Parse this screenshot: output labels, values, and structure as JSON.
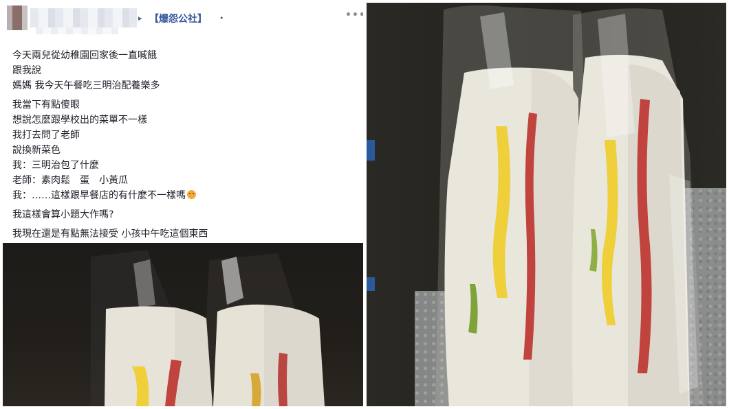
{
  "post": {
    "group_name": "【爆怨公社】",
    "arrow": "▸",
    "dot": "•",
    "more": "•••",
    "lines": [
      "今天兩兒從幼稚園回家後一直喊餓",
      "跟我說",
      "媽媽 我今天午餐吃三明治配養樂多",
      "",
      "我當下有點傻眼",
      "想說怎麼跟學校出的菜單不一樣",
      "我打去問了老師",
      "說換新菜色",
      "我：三明治包了什麼",
      "老師：素肉鬆　蛋　小黃瓜",
      "我：……這樣跟早餐店的有什麼不一樣嗎",
      "",
      "我這樣會算小題大作嗎?",
      "",
      "我現在還是有點無法接受 小孩中午吃這個東西"
    ]
  },
  "icons": {
    "avatar": "profile-avatar",
    "more": "more-options-icon",
    "emoji": "sad-face-emoji-icon"
  },
  "colors": {
    "group_link": "#365899",
    "text": "#1d2129",
    "bread": "#e9e6dc",
    "egg": "#efcf3a",
    "ham": "#c0433e"
  }
}
